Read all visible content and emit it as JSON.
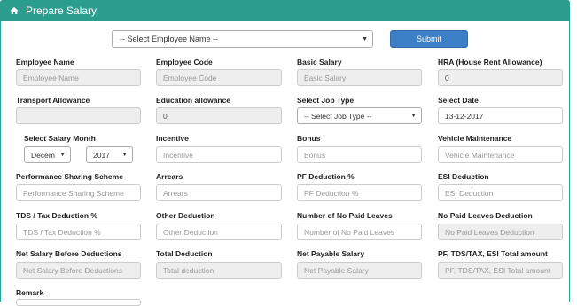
{
  "header": {
    "title": "Prepare Salary",
    "icon": "home-icon",
    "bg_color": "#2a9d8f"
  },
  "top": {
    "employee_select": "-- Select Employee Name --",
    "submit_label": "Submit",
    "submit_color": "#3b7fc4"
  },
  "fields": {
    "employee_name": {
      "label": "Employee Name",
      "placeholder": "Employee Name"
    },
    "employee_code": {
      "label": "Employee Code",
      "placeholder": "Employee Code"
    },
    "basic_salary": {
      "label": "Basic Salary",
      "placeholder": "Basic Salary"
    },
    "hra": {
      "label": "HRA (House Rent Allowance)",
      "value": "0"
    },
    "transport_allowance": {
      "label": "Transport Allowance",
      "value": ""
    },
    "education_allowance": {
      "label": "Education allowance",
      "value": "0"
    },
    "job_type": {
      "label": "Select Job Type",
      "value": "-- Select Job Type --"
    },
    "select_date": {
      "label": "Select Date",
      "value": "13-12-2017"
    },
    "salary_month": {
      "label": "Select Salary Month",
      "month": "Decem",
      "year": "2017"
    },
    "incentive": {
      "label": "Incentive",
      "placeholder": "Incentive"
    },
    "bonus": {
      "label": "Bonus",
      "placeholder": "Bonus"
    },
    "vehicle_maintenance": {
      "label": "Vehicle Maintenance",
      "placeholder": "Vehicle Maintenance"
    },
    "performance_sharing": {
      "label": "Performance Sharing Scheme",
      "placeholder": "Performance Sharing Scheme"
    },
    "arrears": {
      "label": "Arrears",
      "placeholder": "Arrears"
    },
    "pf_deduction": {
      "label": "PF Deduction %",
      "placeholder": "PF Deduction %"
    },
    "esi_deduction": {
      "label": "ESI Deduction",
      "placeholder": "ESI Deduction"
    },
    "tds_deduction": {
      "label": "TDS / Tax Deduction %",
      "placeholder": "TDS / Tax Deduction %"
    },
    "other_deduction": {
      "label": "Other Deduction",
      "placeholder": "Other Deduction"
    },
    "no_paid_leaves": {
      "label": "Number of No Paid Leaves",
      "placeholder": "Number of No Paid Leaves"
    },
    "no_paid_leaves_deduction": {
      "label": "No Paid Leaves Deduction",
      "placeholder": "No Paid Leaves Deduction"
    },
    "net_salary_before": {
      "label": "Net Salary Before Deductions",
      "placeholder": "Net Salary Before Deductions"
    },
    "total_deduction": {
      "label": "Total Deduction",
      "placeholder": "Total deduction"
    },
    "net_payable": {
      "label": "Net Payable Salary",
      "placeholder": "Net Payable Salary"
    },
    "pf_tds_esi_total": {
      "label": "PF, TDS/TAX, ESI Total amount",
      "placeholder": "PF, TDS/TAX, ESI Total amount"
    },
    "remark": {
      "label": "Remark"
    }
  }
}
